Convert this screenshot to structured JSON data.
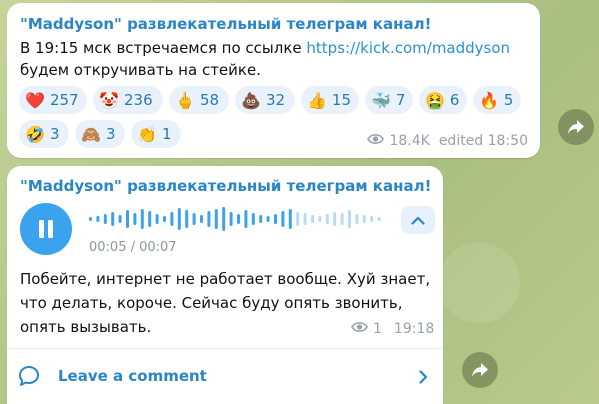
{
  "post1": {
    "channel_title": "\"Maddyson\" развлекательный телеграм канал!",
    "line1_prefix": "В 19:15 мск встречаемся по ссылке ",
    "line1_link": "https://kick.com/maddyson",
    "line2": "будем откручивать на стейке.",
    "reactions": [
      {
        "emoji": "❤️",
        "count": "257"
      },
      {
        "emoji": "🤡",
        "count": "236"
      },
      {
        "emoji": "🖕",
        "count": "58"
      },
      {
        "emoji": "💩",
        "count": "32"
      },
      {
        "emoji": "👍",
        "count": "15"
      },
      {
        "emoji": "🐳",
        "count": "7"
      },
      {
        "emoji": "🤮",
        "count": "6"
      },
      {
        "emoji": "🔥",
        "count": "5"
      },
      {
        "emoji": "🤣",
        "count": "3"
      },
      {
        "emoji": "🙈",
        "count": "3"
      },
      {
        "emoji": "👏",
        "count": "1"
      }
    ],
    "views": "18.4K",
    "edited_time": "edited 18:50"
  },
  "post2": {
    "channel_title": "\"Maddyson\" развлекательный телеграм канал!",
    "voice_duration": "00:05 / 00:07",
    "text_lines": [
      "Побейте, интернет не работает вообще. Хуй знает,",
      "что делать, короче. Сейчас буду опять звонить,",
      "опять вызывать."
    ],
    "views": "1",
    "time": "19:18",
    "comment_label": "Leave a comment"
  },
  "icons": {
    "share": "share-arrow-icon",
    "views": "eye-icon",
    "pause": "pause-icon",
    "collapse": "chevron-up-icon",
    "comment": "comment-bubble-icon",
    "open": "chevron-right-icon"
  },
  "colors": {
    "accent": "#2a86c4",
    "reaction_bg": "#e9f1fa",
    "play_button": "#3ba3ee",
    "meta_text": "#98a2ab"
  }
}
